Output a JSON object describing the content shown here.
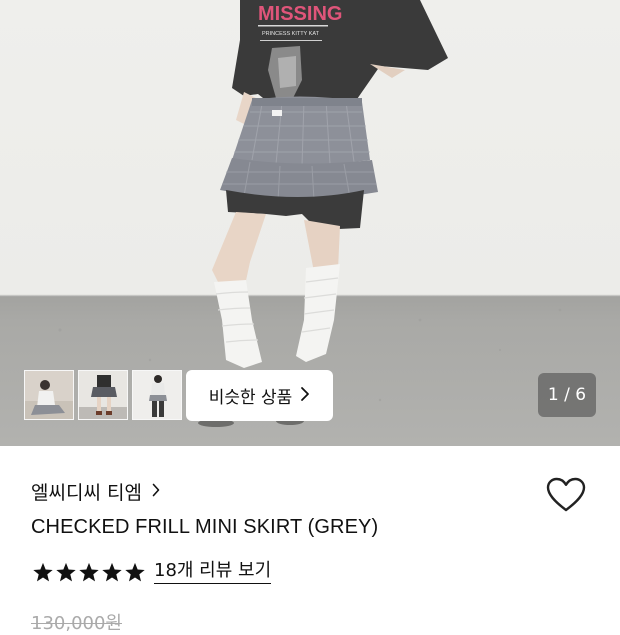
{
  "product_image": {
    "graphic_print": {
      "headline": "MISSING",
      "subline": "PRINCESS KITTY KAT"
    },
    "counter": "1 / 6",
    "similar_button_label": "비슷한 상품",
    "thumbnails": [
      {
        "name": "thumbnail-1"
      },
      {
        "name": "thumbnail-2"
      },
      {
        "name": "thumbnail-3"
      }
    ]
  },
  "product": {
    "brand": "엘씨디씨 티엠",
    "title": "CHECKED FRILL MINI SKIRT (GREY)",
    "rating_stars": 5,
    "review_link": "18개 리뷰 보기",
    "price": "130,000원"
  },
  "colors": {
    "star": "#111111",
    "text": "#111111",
    "muted_price": "#aaaaaa"
  }
}
